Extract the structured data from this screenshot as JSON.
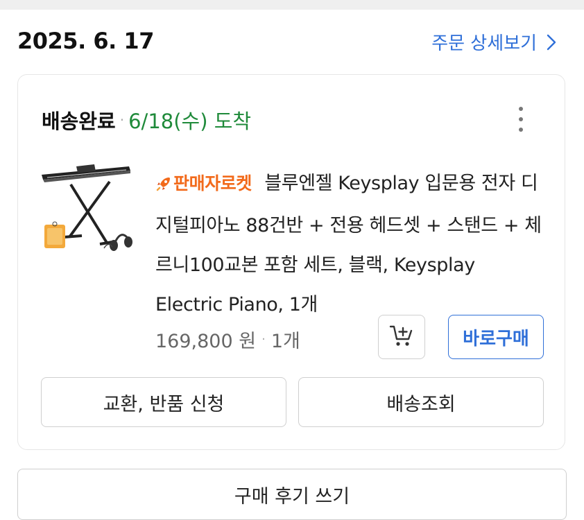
{
  "order": {
    "date": "2025. 6. 17",
    "detail_link_label": "주문 상세보기",
    "detail_link_icon": "chevron-right-icon"
  },
  "shipment": {
    "status": "배송완료",
    "separator": "·",
    "arrival": "6/18(수) 도착",
    "arrival_color": "#1f8a3a",
    "menu_icon": "more-vertical-icon"
  },
  "product": {
    "image_icon": "digital-piano-with-stand-and-headset",
    "badge_label": "판매자로켓",
    "badge_icon": "rocket-icon",
    "badge_color": "#f26a1b",
    "title": "블루엔젤 Keysplay 입문용 전자 디지털피아노 88건반 + 전용 헤드셋 + 스탠드 + 체르니100교본 포함 세트, 블랙, Keysplay Electric Piano, 1개",
    "price": "169,800 원",
    "separator": "·",
    "quantity": "1개",
    "cart_icon": "add-to-cart-icon",
    "buy_now_label": "바로구매",
    "accent_color": "#2f6fd8"
  },
  "actions": {
    "exchange_return_label": "교환, 반품 신청",
    "tracking_label": "배송조회"
  },
  "review": {
    "write_review_label": "구매 후기 쓰기"
  }
}
